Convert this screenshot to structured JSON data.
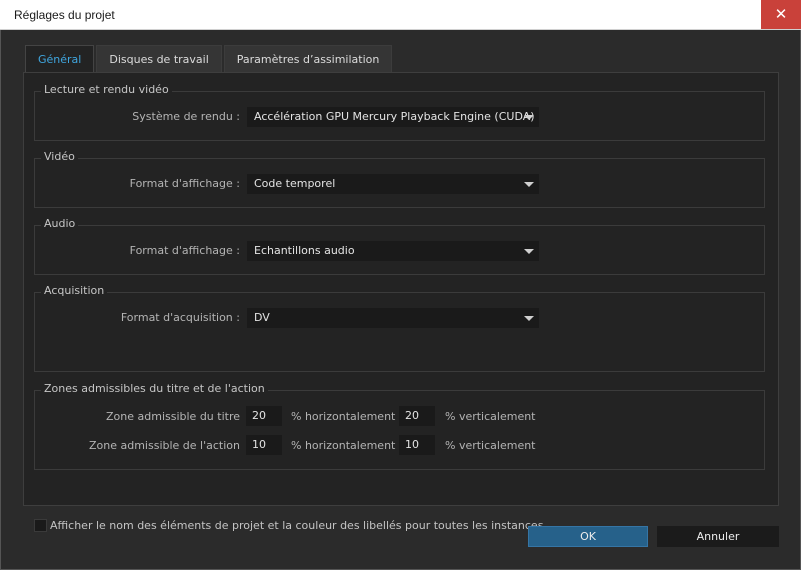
{
  "window": {
    "title": "Réglages du projet",
    "close_glyph": "✕"
  },
  "tabs": [
    {
      "label": "Général",
      "active": true
    },
    {
      "label": "Disques de travail",
      "active": false
    },
    {
      "label": "Paramètres d’assimilation",
      "active": false
    }
  ],
  "groups": {
    "playback": {
      "title": "Lecture et rendu vidéo",
      "label": "Système de rendu :",
      "value": "Accélération GPU Mercury Playback Engine (CUDA)"
    },
    "video": {
      "title": "Vidéo",
      "label": "Format d'affichage :",
      "value": "Code temporel"
    },
    "audio": {
      "title": "Audio",
      "label": "Format d'affichage :",
      "value": "Echantillons audio"
    },
    "capture": {
      "title": "Acquisition",
      "label": "Format d'acquisition :",
      "value": "DV"
    },
    "safe": {
      "title": "Zones admissibles du titre et de l'action",
      "title_label": "Zone admissible du titre",
      "action_label": "Zone admissible de l'action",
      "title_h": "20",
      "title_v": "20",
      "action_h": "10",
      "action_v": "10",
      "h_unit": "% horizontalement",
      "v_unit": "% verticalement"
    }
  },
  "checkbox": {
    "label": "Afficher le nom des éléments de projet et la couleur des libellés pour toutes les instances",
    "checked": false
  },
  "buttons": {
    "ok": "OK",
    "cancel": "Annuler"
  },
  "colors": {
    "accent": "#3fa6df",
    "ok_button": "#26618a",
    "close_button": "#c9413a"
  }
}
